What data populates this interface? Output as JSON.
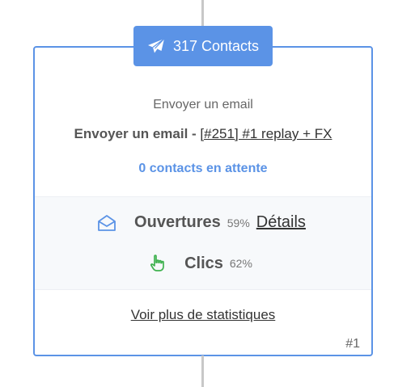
{
  "badge": {
    "icon": "paper-plane-icon",
    "label": "317 Contacts"
  },
  "step": {
    "type_label": "Envoyer un email",
    "title_prefix": "Envoyer un email - ",
    "title_link": "[#251] #1 replay + FX",
    "waiting_label": "0 contacts en attente",
    "number": "#1"
  },
  "stats": {
    "opens": {
      "icon": "envelope-open-icon",
      "label": "Ouvertures",
      "percent": "59%",
      "details_link": "Détails"
    },
    "clicks": {
      "icon": "pointing-hand-icon",
      "label": "Clics",
      "percent": "62%"
    }
  },
  "more_stats_link": "Voir plus de statistiques",
  "colors": {
    "accent": "#5b93e6",
    "click_icon": "#3fb24f",
    "connector": "#c8c8c8"
  }
}
